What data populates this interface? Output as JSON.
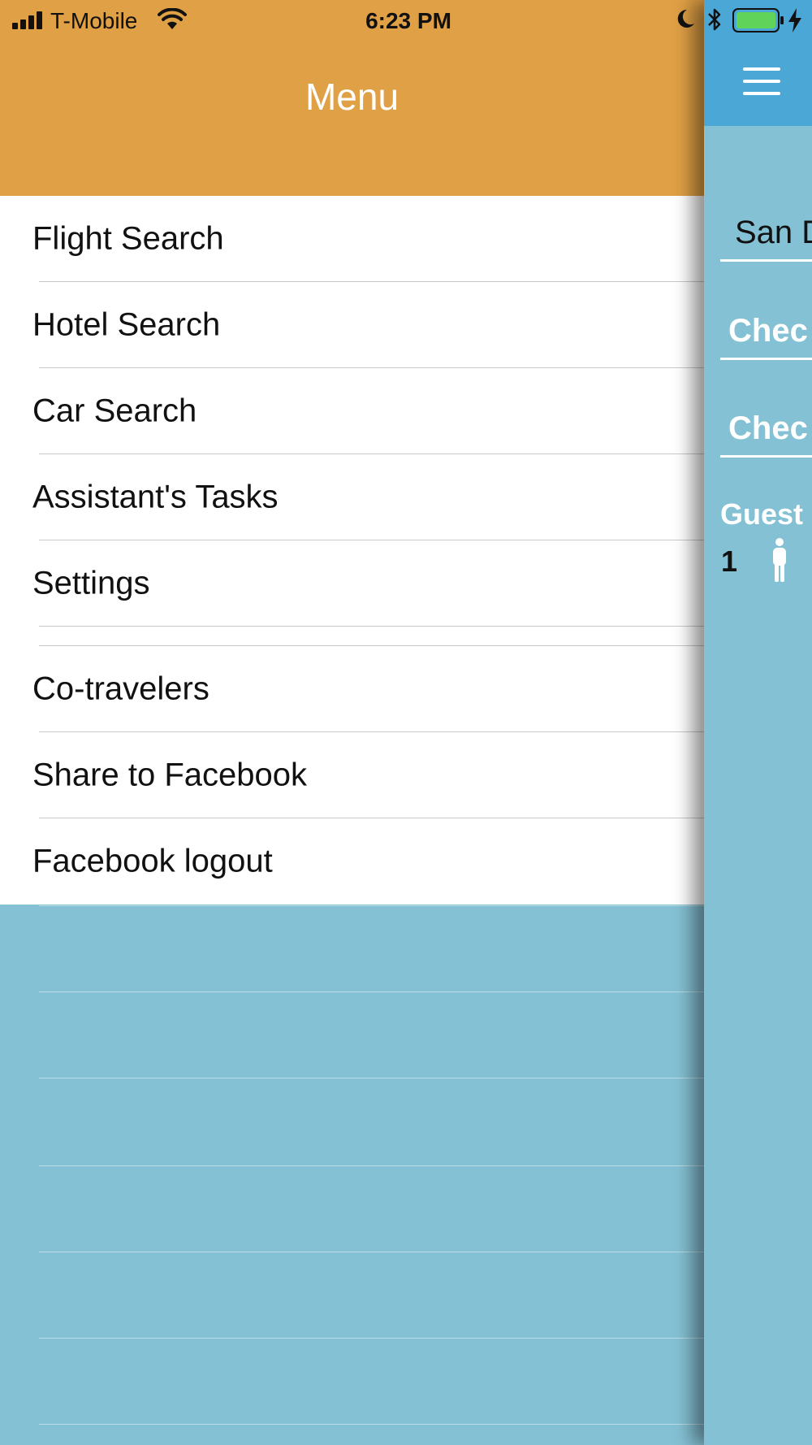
{
  "status_bar": {
    "carrier": "T-Mobile",
    "time": "6:23 PM",
    "icons": [
      "signal-icon",
      "wifi-icon",
      "moon-icon",
      "bluetooth-icon",
      "battery-icon",
      "charging-icon"
    ]
  },
  "drawer": {
    "title": "Menu",
    "header_color": "#e0a045",
    "items": [
      {
        "label": "Flight Search"
      },
      {
        "label": "Hotel Search"
      },
      {
        "label": "Car Search"
      },
      {
        "label": "Assistant's Tasks"
      },
      {
        "label": "Settings"
      }
    ],
    "secondary_items": [
      {
        "label": "Co-travelers"
      },
      {
        "label": "Share to Facebook"
      },
      {
        "label": "Facebook logout"
      }
    ]
  },
  "main_panel": {
    "navbar_color": "#4aa7d6",
    "background_color": "#85c1d4",
    "menu_icon": "hamburger-icon",
    "destination_value": "San D",
    "checkin_placeholder": "Chec",
    "checkout_placeholder": "Chec",
    "guests_label": "Guest",
    "guests_count": "1",
    "guest_icon": "person-icon"
  }
}
